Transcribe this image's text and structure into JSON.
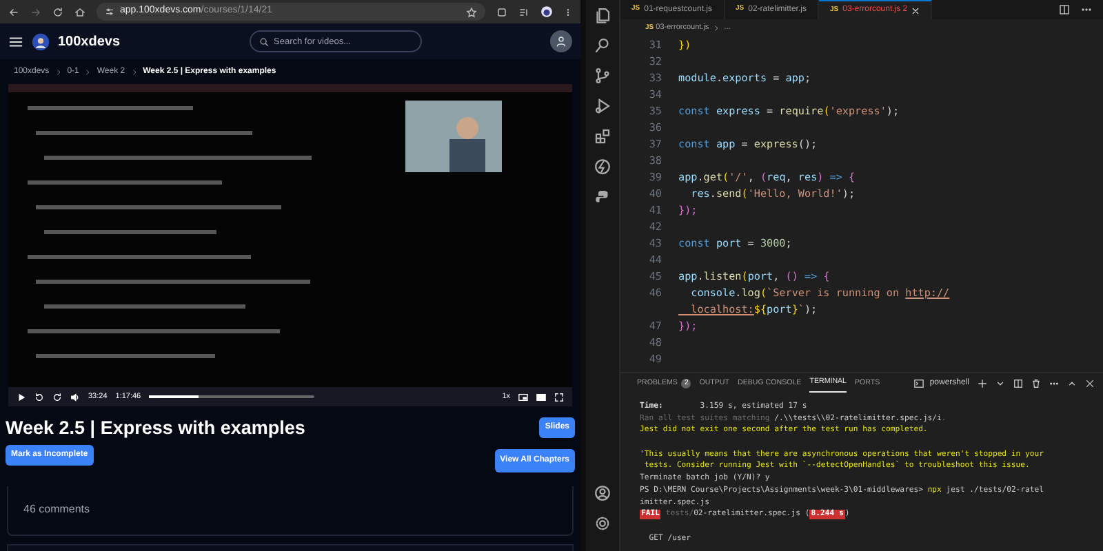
{
  "browser": {
    "url_host": "app.100xdevs.com",
    "url_path": "/courses/1/14/21"
  },
  "site": {
    "brand": "100xdevs",
    "search": {
      "placeholder": "Search for videos..."
    }
  },
  "breadcrumbs": [
    {
      "label": "100xdevs",
      "current": false
    },
    {
      "label": "0-1",
      "current": false
    },
    {
      "label": "Week 2",
      "current": false
    },
    {
      "label": "Week 2.5 | Express with examples",
      "current": true
    }
  ],
  "video": {
    "kind": "picture",
    "player": {
      "elapsed": "33:24",
      "duration": "1:17:46",
      "level": 0.3,
      "speed": "1x"
    }
  },
  "lesson": {
    "title": "Week 2.5 | Express with examples",
    "slides_button": "Slides",
    "mark_button": "Mark as Incomplete",
    "chapters_button": "View All Chapters"
  },
  "comments": {
    "count_label": "46 comments"
  },
  "editor": {
    "tabs": [
      {
        "file_icon": "JS",
        "label": "01-requestcount.js",
        "has_errors": false,
        "selected": false
      },
      {
        "file_icon": "JS",
        "label": "02-ratelimitter.js",
        "has_errors": false,
        "selected": false
      },
      {
        "file_icon": "JS",
        "label": "03-errorcount.js",
        "problems": "2",
        "has_errors": true,
        "selected": true
      }
    ],
    "breadcrumb": {
      "file_icon": "JS",
      "file": "03-errorcount.js",
      "rest": "..."
    },
    "lines": [
      {
        "number": "31",
        "tokens": [
          {
            "text": "})",
            "kind": "bracket"
          }
        ]
      },
      {
        "number": "32"
      },
      {
        "number": "33",
        "tokens": [
          {
            "text": "module",
            "kind": "var"
          },
          {
            "text": ".",
            "kind": "punct"
          },
          {
            "text": "exports",
            "kind": "var"
          },
          {
            "text": " = ",
            "kind": "punct"
          },
          {
            "text": "app",
            "kind": "var"
          },
          {
            "text": ";",
            "kind": "punct"
          }
        ]
      },
      {
        "number": "34"
      },
      {
        "number": "35",
        "tokens": [
          {
            "text": "const ",
            "kind": "keyword"
          },
          {
            "text": "express",
            "kind": "var"
          },
          {
            "text": " = ",
            "kind": "punct"
          },
          {
            "text": "require",
            "kind": "func"
          },
          {
            "text": "(",
            "kind": "bracket"
          },
          {
            "text": "'express'",
            "kind": "string"
          },
          {
            "text": ");",
            "kind": "punct"
          }
        ]
      },
      {
        "number": "36"
      },
      {
        "number": "37",
        "tokens": [
          {
            "text": "const ",
            "kind": "keyword"
          },
          {
            "text": "app",
            "kind": "var"
          },
          {
            "text": " = ",
            "kind": "punct"
          },
          {
            "text": "express",
            "kind": "func"
          },
          {
            "text": "();",
            "kind": "punct"
          }
        ]
      },
      {
        "number": "38"
      },
      {
        "number": "39",
        "tokens": [
          {
            "text": "app",
            "kind": "var"
          },
          {
            "text": ".",
            "kind": "punct"
          },
          {
            "text": "get",
            "kind": "func"
          },
          {
            "text": "(",
            "kind": "bracket"
          },
          {
            "text": "'/'",
            "kind": "string"
          },
          {
            "text": ", ",
            "kind": "punct"
          },
          {
            "text": "(",
            "kind": "bracket2"
          },
          {
            "text": "req",
            "kind": "var"
          },
          {
            "text": ", ",
            "kind": "punct"
          },
          {
            "text": "res",
            "kind": "var"
          },
          {
            "text": ")",
            "kind": "bracket2"
          },
          {
            "text": " => ",
            "kind": "keyword"
          },
          {
            "text": "{",
            "kind": "bracket2"
          }
        ]
      },
      {
        "number": "40",
        "tokens": [
          {
            "text": "  res",
            "kind": "var"
          },
          {
            "text": ".",
            "kind": "punct"
          },
          {
            "text": "send",
            "kind": "func"
          },
          {
            "text": "(",
            "kind": "bracket"
          },
          {
            "text": "'Hello, World!'",
            "kind": "string"
          },
          {
            "text": ");",
            "kind": "punct"
          }
        ]
      },
      {
        "number": "41",
        "tokens": [
          {
            "text": "});",
            "kind": "bracket2"
          }
        ]
      },
      {
        "number": "42"
      },
      {
        "number": "43",
        "tokens": [
          {
            "text": "const ",
            "kind": "keyword"
          },
          {
            "text": "port",
            "kind": "var"
          },
          {
            "text": " = ",
            "kind": "punct"
          },
          {
            "text": "3000",
            "kind": "number"
          },
          {
            "text": ";",
            "kind": "punct"
          }
        ]
      },
      {
        "number": "44"
      },
      {
        "number": "45",
        "tokens": [
          {
            "text": "app",
            "kind": "var"
          },
          {
            "text": ".",
            "kind": "punct"
          },
          {
            "text": "listen",
            "kind": "func"
          },
          {
            "text": "(",
            "kind": "bracket"
          },
          {
            "text": "port",
            "kind": "var"
          },
          {
            "text": ", ",
            "kind": "punct"
          },
          {
            "text": "()",
            "kind": "bracket2"
          },
          {
            "text": " => ",
            "kind": "keyword"
          },
          {
            "text": "{",
            "kind": "bracket2"
          }
        ]
      },
      {
        "number": "46",
        "tokens": [
          {
            "text": "  console",
            "kind": "var"
          },
          {
            "text": ".",
            "kind": "punct"
          },
          {
            "text": "log",
            "kind": "func"
          },
          {
            "text": "(",
            "kind": "bracket"
          },
          {
            "text": "`Server is running on ",
            "kind": "string"
          },
          {
            "text": "http://",
            "kind": "link"
          }
        ]
      },
      {
        "tokens": [
          {
            "text": "  localhost:",
            "kind": "link"
          },
          {
            "text": "${",
            "kind": "bracket"
          },
          {
            "text": "port",
            "kind": "var"
          },
          {
            "text": "}",
            "kind": "bracket"
          },
          {
            "text": "`",
            "kind": "string"
          },
          {
            "text": ");",
            "kind": "punct"
          }
        ]
      },
      {
        "number": "47",
        "tokens": [
          {
            "text": "});",
            "kind": "bracket2"
          }
        ]
      },
      {
        "number": "48"
      },
      {
        "number": "49"
      }
    ],
    "panel_tabs": [
      {
        "label": "PROBLEMS",
        "badge": "2",
        "selected": false
      },
      {
        "label": "OUTPUT",
        "selected": false
      },
      {
        "label": "DEBUG CONSOLE",
        "selected": false
      },
      {
        "label": "TERMINAL",
        "selected": true
      },
      {
        "label": "PORTS",
        "selected": false
      }
    ],
    "shell": "powershell",
    "terminal": [
      {
        "segments": [
          {
            "text": "Time:",
            "kind": "bold"
          },
          {
            "text": "        3.159 s, estimated 17 s",
            "kind": "plain"
          }
        ]
      },
      {
        "segments": [
          {
            "text": "Ran all test suites matching ",
            "kind": "dim"
          },
          {
            "text": "/.\\\\tests\\\\02-ratelimitter.spec.js/i",
            "kind": "plain"
          },
          {
            "text": ".",
            "kind": "dim"
          }
        ]
      },
      {
        "segments": [
          {
            "text": "Jest did not exit one second after the test run has completed.",
            "kind": "warn"
          }
        ]
      },
      {
        "gap_before": true,
        "segments": [
          {
            "text": "'This usually means that there are asynchronous operations that weren't stopped in your",
            "kind": "warn"
          }
        ]
      },
      {
        "segments": [
          {
            "text": " tests. Consider running Jest with `--detectOpenHandles` to troubleshoot this issue.",
            "kind": "warn"
          }
        ]
      },
      {
        "segments": [
          {
            "text": "Terminate batch job (Y/N)? y",
            "kind": "plain"
          }
        ]
      },
      {
        "segments": [
          {
            "text": "PS D:\\MERN Course\\Projects\\Assignments\\week-3\\01-middlewares> ",
            "kind": "plain"
          },
          {
            "text": "npx",
            "kind": "command"
          },
          {
            "text": " jest ./tests/02-ratel",
            "kind": "plain"
          }
        ]
      },
      {
        "segments": [
          {
            "text": "imitter.spec.js",
            "kind": "plain"
          }
        ]
      },
      {
        "segments": [
          {
            "text": "FAIL",
            "kind": "fail_badge"
          },
          {
            "text": " tests/",
            "kind": "dim"
          },
          {
            "text": "02-ratelimitter.spec.js",
            "kind": "plain"
          },
          {
            "text": " (",
            "kind": "plain"
          },
          {
            "text": "8.244 s",
            "kind": "slow_badge"
          },
          {
            "text": ")",
            "kind": "plain"
          }
        ]
      },
      {
        "gap_before": true,
        "segments": [
          {
            "text": "  GET /user",
            "kind": "plain"
          }
        ]
      }
    ]
  }
}
